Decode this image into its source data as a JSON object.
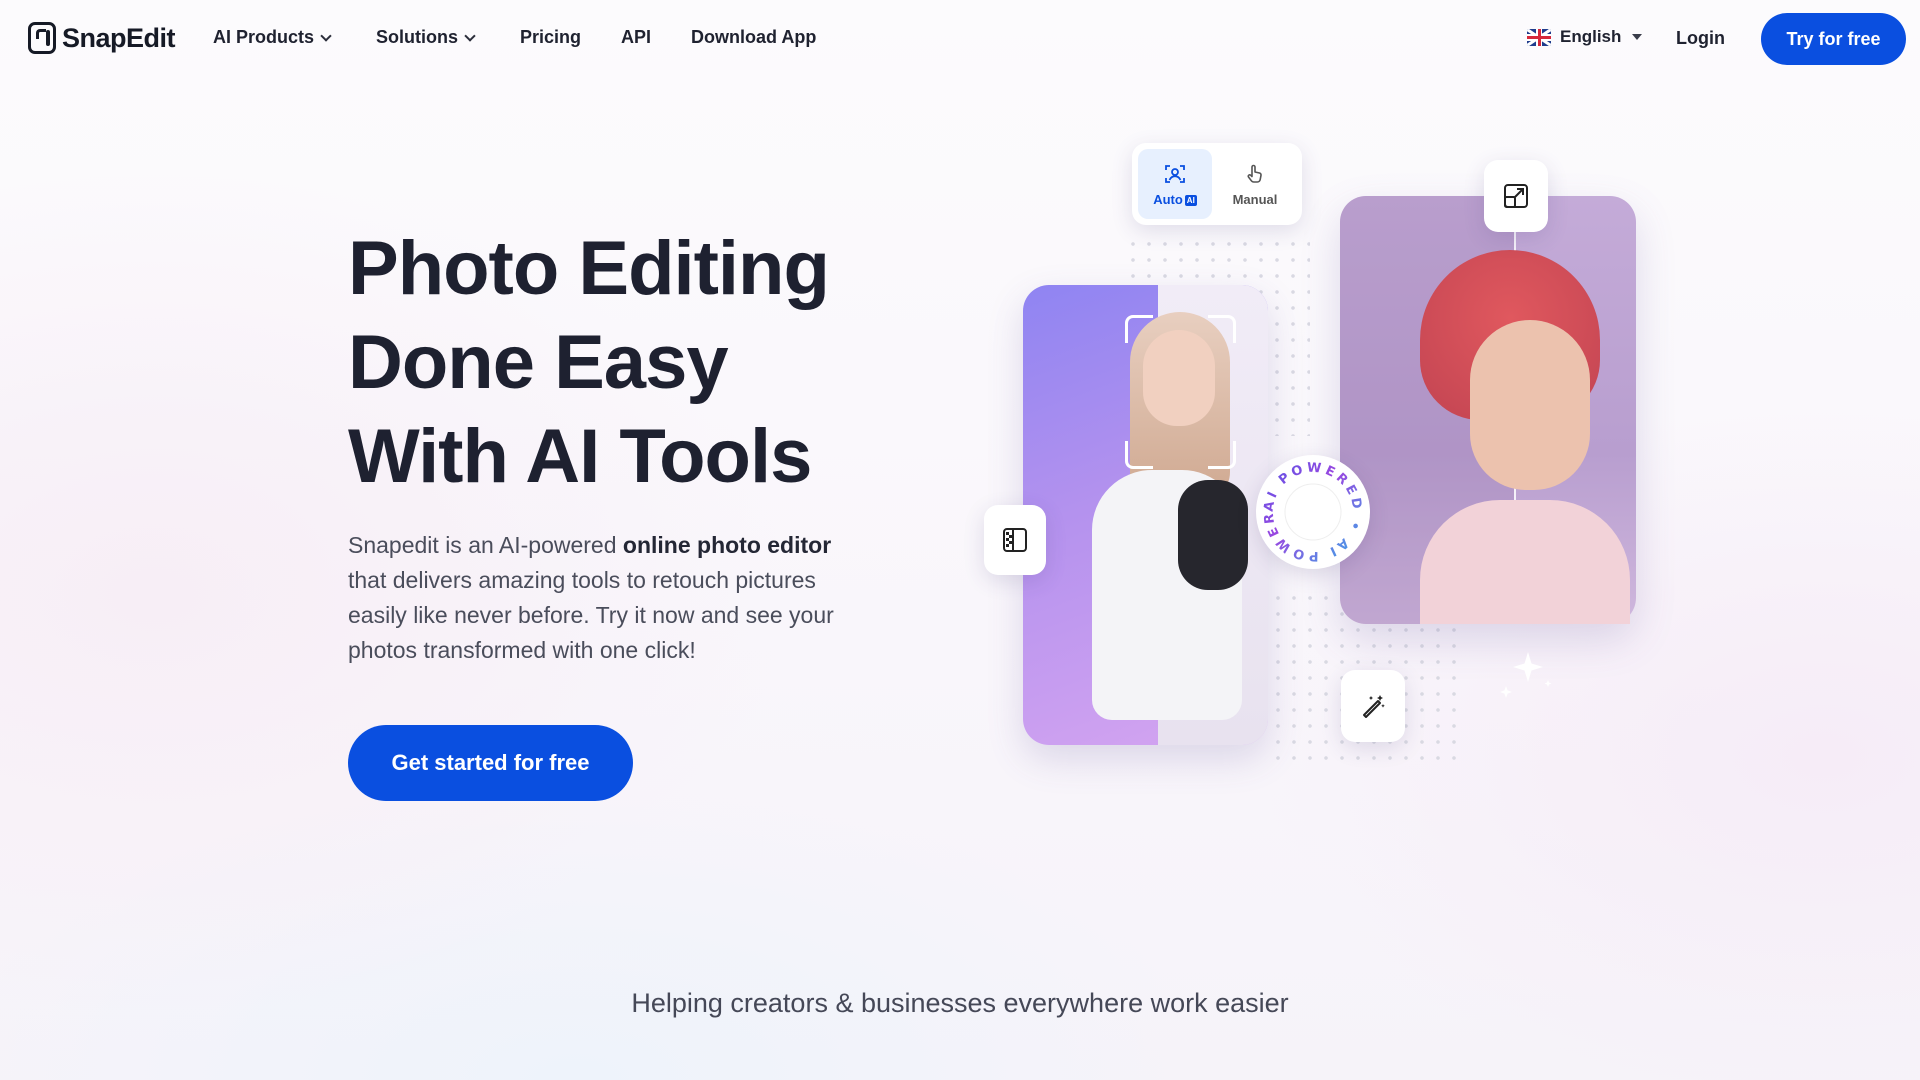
{
  "brand": {
    "name": "SnapEdit"
  },
  "nav": {
    "items": [
      {
        "label": "AI Products",
        "has_dropdown": true
      },
      {
        "label": "Solutions",
        "has_dropdown": true
      },
      {
        "label": "Pricing",
        "has_dropdown": false
      },
      {
        "label": "API",
        "has_dropdown": false
      },
      {
        "label": "Download App",
        "has_dropdown": false
      }
    ]
  },
  "language": {
    "selected": "English",
    "flag_icon": "uk-flag-icon"
  },
  "header": {
    "login_label": "Login",
    "try_label": "Try for free"
  },
  "hero": {
    "title_lines": [
      "Photo Editing",
      "Done Easy",
      "With AI Tools"
    ],
    "desc_before": "Snapedit is an AI-powered ",
    "desc_bold": "online photo editor",
    "desc_after": " that delivers amazing tools to retouch pictures easily like never before. Try it now and see your photos transformed with one click!",
    "cta_label": "Get started for free"
  },
  "illustration": {
    "modes": [
      {
        "label": "Auto",
        "badge": "AI",
        "icon": "face-scan-icon",
        "active": true
      },
      {
        "label": "Manual",
        "icon": "hand-pointer-icon",
        "active": false
      }
    ],
    "badge_text": "AI POWERED • AI POWERED •",
    "tool_icons": [
      "compare-panel-icon",
      "external-link-icon",
      "magic-wand-icon",
      "sparkle-icon"
    ]
  },
  "tagline": "Helping creators & businesses everywhere work easier",
  "colors": {
    "primary": "#0a4fe0",
    "text_dark": "#1e2130",
    "text_muted": "#4a4d5b"
  }
}
